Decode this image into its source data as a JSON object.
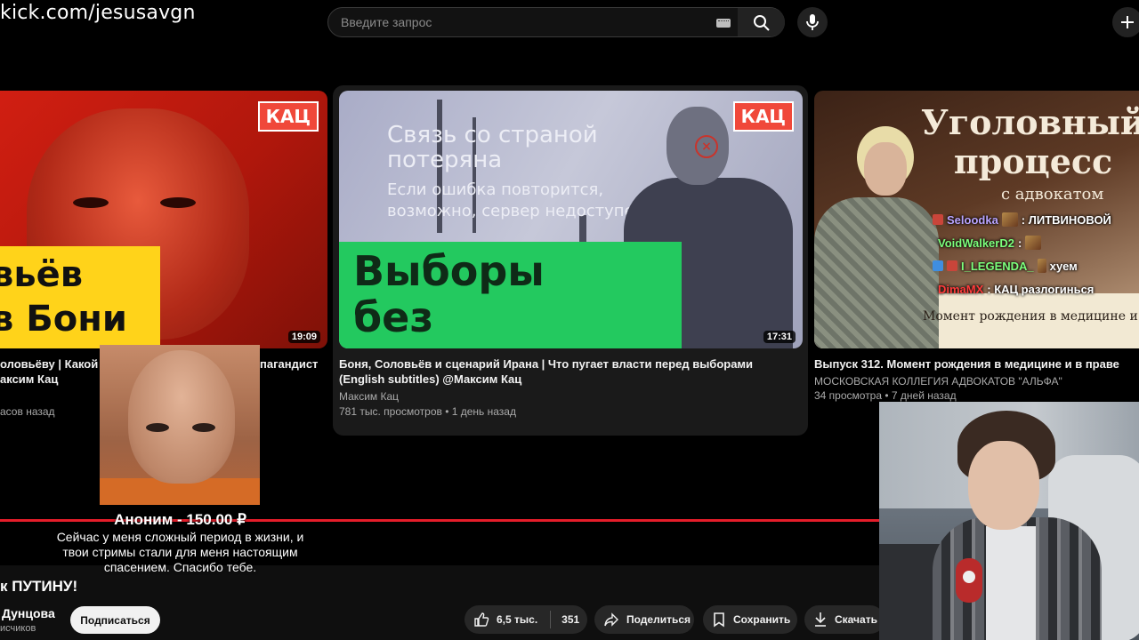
{
  "stream": {
    "url": "kick.com/jesusavgn"
  },
  "search": {
    "placeholder": "Введите запрос"
  },
  "videos": [
    {
      "badge": "КАЦ",
      "thumb_line1": "вьёв",
      "thumb_line2": "в Бони",
      "duration": "19:09",
      "title_line1": "оловьёву | Какой в",
      "title_line1_tail": "пагандист",
      "title_line2": "аксим Кац",
      "meta": "асов назад"
    },
    {
      "badge": "КАЦ",
      "thumb_line1a": "Связь со страной",
      "thumb_line1b": "потеряна",
      "thumb_line2a": "Если ошибка повторится,",
      "thumb_line2b": "возможно, сервер недоступен.",
      "thumb_big1": "Выборы",
      "thumb_big2": "без интернета",
      "duration": "17:31",
      "title_line1": "Боня, Соловьёв и сценарий Ирана | Что пугает власти перед выборами",
      "title_line2": "(English subtitles) @Максим Кац",
      "channel": "Максим Кац",
      "meta": "781 тыс. просмотров • 1 день назад"
    },
    {
      "thumb_title1": "Уголовный",
      "thumb_title2": "процесс",
      "thumb_sub": "с адвокатом",
      "thumb_caption": "Момент рождения в медицине и п",
      "title_line1": "Выпуск 312. Момент рождения в медицине и в праве",
      "channel": "МОСКОВСКАЯ КОЛЛЕГИЯ АДВОКАТОВ \"АЛЬФА\"",
      "meta": "34 просмотра • 7 дней назад"
    }
  ],
  "chat": [
    {
      "user": "Seloodka",
      "text": ": ЛИТВИНОВОЙ",
      "color": "#b9a4ff"
    },
    {
      "user": "VoidWalkerD2",
      "text": ":",
      "color": "#7cff7c"
    },
    {
      "user": "I_LEGENDA_",
      "text": "хуем",
      "color": "#7cff7c"
    },
    {
      "user": "DimaMX",
      "text": ": КАЦ разлогинься",
      "color": "#ff3b3b"
    }
  ],
  "donation": {
    "name": "Аноним - 150.00 ₽",
    "message": "Сейчас у меня сложный период в жизни, и твои стримы стали для меня настоящим спасением. Спасибо тебе."
  },
  "current_video": {
    "title": "к ПУТИНУ!",
    "channel": "Дунцова",
    "subscribers": "исчиков",
    "subscribe": "Подписаться",
    "likes": "6,5 тыс.",
    "dislikes": "351",
    "share": "Поделиться",
    "save": "Сохранить",
    "download": "Скачать"
  },
  "colors": {
    "accent_red": "#e51d2a",
    "kac_badge": "#f0483a",
    "green_banner": "#23c95f",
    "yellow_banner": "#ffd31a"
  },
  "icons": [
    "keyboard-icon",
    "search-icon",
    "mic-icon",
    "create-icon",
    "thumbs-up-icon",
    "share-icon",
    "bookmark-icon",
    "download-icon"
  ]
}
